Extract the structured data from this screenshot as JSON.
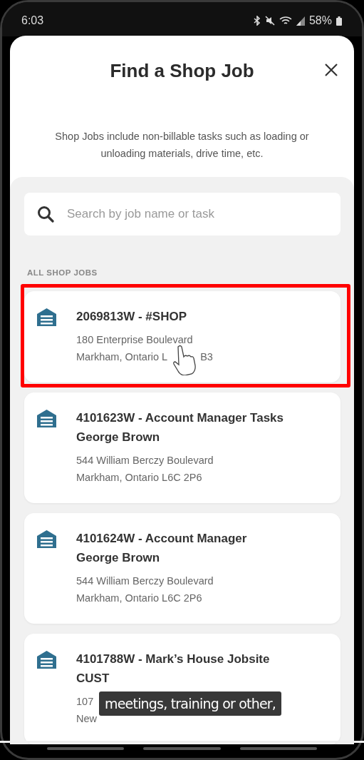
{
  "status_bar": {
    "time": "6:03",
    "battery": "58%"
  },
  "header": {
    "title": "Find a Shop Job"
  },
  "description": "Shop Jobs include non-billable tasks such as loading or unloading materials, drive time, etc.",
  "search": {
    "placeholder": "Search by job name or task"
  },
  "section_label": "ALL SHOP JOBS",
  "jobs": [
    {
      "title": "2069813W - #SHOP",
      "address": [
        [
          "180 Enterprise Boulevard"
        ],
        [
          "Markham, Ontario L",
          "B3"
        ]
      ],
      "highlighted": true,
      "pointer": true
    },
    {
      "title": "4101623W - Account Manager Tasks George Brown",
      "address": [
        [
          "544 William Berczy Boulevard"
        ],
        [
          "Markham, Ontario L6C 2P6"
        ]
      ],
      "highlighted": false,
      "pointer": false
    },
    {
      "title": "4101624W - Account Manager George Brown",
      "address": [
        [
          "544 William Berczy Boulevard"
        ],
        [
          "Markham, Ontario L6C 2P6"
        ]
      ],
      "highlighted": false,
      "pointer": false
    },
    {
      "title": "4101788W - Mark’s House Jobsite CUST",
      "address": [
        [
          "107"
        ],
        [
          "New"
        ]
      ],
      "highlighted": false,
      "pointer": false
    }
  ],
  "caption": {
    "text": "meetings, training or other,"
  }
}
